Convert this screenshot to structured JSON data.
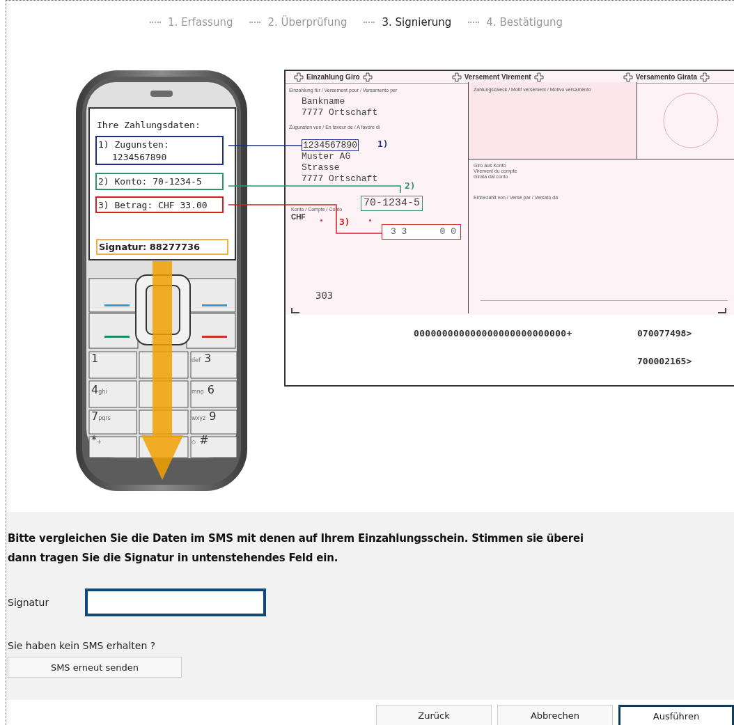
{
  "steps": [
    {
      "label": "1. Erfassung",
      "selected": false
    },
    {
      "label": "2. Überprüfung",
      "selected": false
    },
    {
      "label": "3. Signierung",
      "selected": true
    },
    {
      "label": "4. Bestätigung",
      "selected": false
    }
  ],
  "phone": {
    "title": "Ihre Zahlungsdaten:",
    "items": [
      {
        "lines": [
          "1) Zugunsten:",
          "1234567890"
        ],
        "color": "#1b2f8e"
      },
      {
        "lines": [
          "2) Konto: 70-1234-5"
        ],
        "color": "#2e9468"
      },
      {
        "lines": [
          "3) Betrag: CHF 33.00"
        ],
        "color": "#d41f1f"
      }
    ],
    "signature": "Signatur: 88277736",
    "keys": [
      {
        "digit": "1"
      },
      {
        "digit": "3",
        "letters": "def"
      },
      {
        "digit": "4",
        "letters": "ghi"
      },
      {
        "digit": "6",
        "letters": "mno"
      },
      {
        "digit": "7",
        "letters": "pqrs"
      },
      {
        "digit": "9",
        "letters": "wxyz"
      },
      {
        "digit": "*",
        "letters": "+"
      },
      {
        "digit": "#",
        "letters": "◇"
      }
    ]
  },
  "slip": {
    "headers": [
      "Einzahlung Giro",
      "Versement Virement",
      "Versamento Girata"
    ],
    "payer_caption": "Einzahlung für / Versement pour / Versamento per",
    "bank_lines": [
      "Bankname",
      "7777 Ortschaft"
    ],
    "beneficiary_caption": "Zugunsten von / En faveur de / A favore di",
    "reference": "1234567890",
    "reference_tag": "1)",
    "beneficiary_lines": [
      "Muster AG",
      "Strasse",
      "7777 Ortschaft"
    ],
    "account_tag": "2)",
    "account_caption": "Konto / Compte / Conto",
    "account": "70-1234-5",
    "currency": "CHF",
    "amount_tag": "3)",
    "amount_francs": "3 3",
    "amount_cents": "0 0",
    "purpose_caption": "Zahlungszweck / Motif versement / Motivo versamento",
    "giro_caption": [
      "Giro aus Konto",
      "Virement du compte",
      "Girata dal conto"
    ],
    "paid_by_caption": "Einbezahlt von / Versé par / Versato da",
    "code": "303",
    "codeline": "000000000000000000000000000+",
    "codeline_ref": "070077498>",
    "codeline_2": "700002165>"
  },
  "form": {
    "instruction": [
      "Bitte vergleichen Sie die Daten im SMS mit denen auf Ihrem Einzahlungsschein. Stimmen sie überei",
      "dann tragen Sie die Signatur in untenstehendes Feld ein."
    ],
    "signature_label": "Signatur",
    "signature_focused": true,
    "no_sms": "Sie haben kein SMS erhalten ?",
    "resend": "SMS erneut senden"
  },
  "buttons": [
    {
      "label": "Zurück",
      "kind": "default"
    },
    {
      "label": "Abbrechen",
      "kind": "default"
    },
    {
      "label": "Ausführen",
      "kind": "primary"
    }
  ]
}
